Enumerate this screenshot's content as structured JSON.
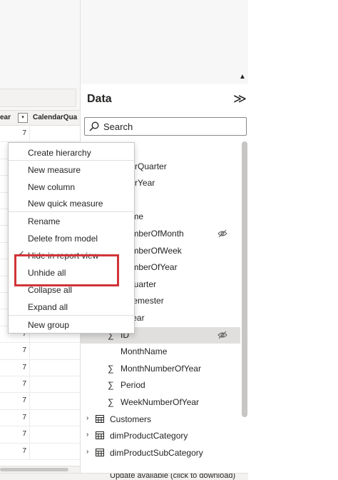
{
  "grid": {
    "col_year": "ear",
    "col_year_filter": "▾",
    "col_quarter": "CalendarQua",
    "rows": [
      "7",
      "7",
      "7",
      "7",
      "7",
      "7",
      "7",
      "7",
      "7",
      "7",
      "7",
      "7",
      "7",
      "7",
      "7",
      "7",
      "7",
      "7",
      "7",
      "7"
    ]
  },
  "data_pane": {
    "title": "Data",
    "collapse_glyph": "≫",
    "scroll_up_glyph": "▲",
    "search_placeholder": "Search",
    "fields": [
      {
        "label": "ar",
        "sigma": ""
      },
      {
        "label": "ndarQuarter",
        "sigma": ""
      },
      {
        "label": "ndarYear",
        "sigma": ""
      },
      {
        "label": "e",
        "sigma": ""
      },
      {
        "label": "Name",
        "sigma": ""
      },
      {
        "label": "NumberOfMonth",
        "sigma": "",
        "hidden": true
      },
      {
        "label": "NumberOfWeek",
        "sigma": ""
      },
      {
        "label": "NumberOfYear",
        "sigma": ""
      },
      {
        "label": "alQuarter",
        "sigma": ""
      },
      {
        "label": "alSemester",
        "sigma": ""
      },
      {
        "label": "alYear",
        "sigma": ""
      },
      {
        "label": "ID",
        "sigma": "∑",
        "hidden": true,
        "selected": true
      },
      {
        "label": "MonthName",
        "sigma": ""
      },
      {
        "label": "MonthNumberOfYear",
        "sigma": "∑"
      },
      {
        "label": "Period",
        "sigma": "∑"
      },
      {
        "label": "WeekNumberOfYear",
        "sigma": "∑"
      }
    ],
    "tables": [
      {
        "label": "Customers",
        "chevron": "›"
      },
      {
        "label": "dimProductCategory",
        "chevron": "›"
      },
      {
        "label": "dimProductSubCategory",
        "chevron": "›"
      }
    ]
  },
  "context_menu": {
    "items": [
      {
        "label": "Create hierarchy"
      },
      {
        "label": "New measure"
      },
      {
        "label": "New column"
      },
      {
        "label": "New quick measure"
      },
      {
        "label": "Rename"
      },
      {
        "label": "Delete from model"
      },
      {
        "label": "Hide in report view",
        "checked": true
      },
      {
        "label": "Unhide all"
      },
      {
        "label": "Collapse all"
      },
      {
        "label": "Expand all"
      },
      {
        "label": "New group"
      }
    ]
  },
  "status_bar": {
    "update_text": "Update available (click to download)"
  },
  "colors": {
    "highlight": "#d13438",
    "selected_row": "#e1dfdd"
  }
}
